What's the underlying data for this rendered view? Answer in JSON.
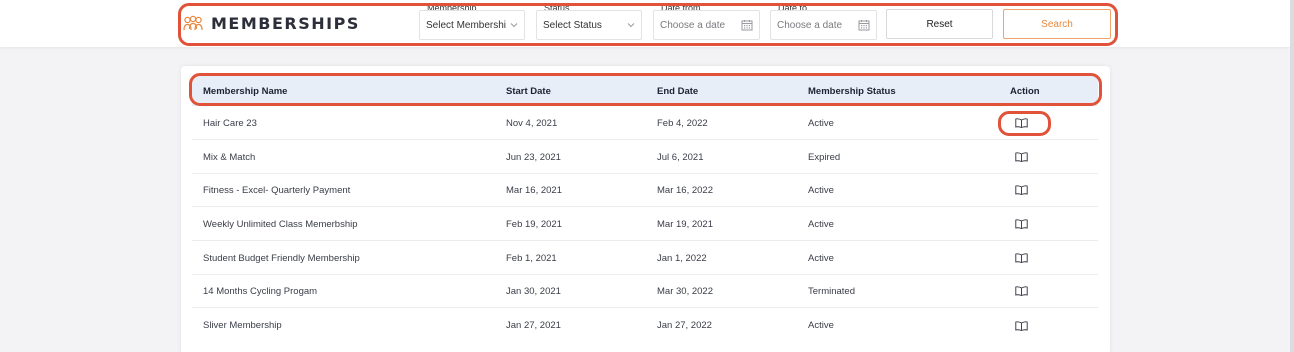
{
  "app": {
    "title": "MEMBERSHIPS",
    "logo_icon": "users-icon",
    "accent_color": "#e8883e",
    "highlight_color": "#e0533a"
  },
  "filters": {
    "membership": {
      "label": "Membership",
      "value": "Select Membershi",
      "icon": "chevron-down-icon"
    },
    "status": {
      "label": "Status",
      "value": "Select Status",
      "icon": "chevron-down-icon"
    },
    "date_from": {
      "label": "Date from",
      "placeholder": "Choose a date",
      "icon": "calendar-icon"
    },
    "date_to": {
      "label": "Date to",
      "placeholder": "Choose a date",
      "icon": "calendar-icon"
    },
    "reset_label": "Reset",
    "search_label": "Search"
  },
  "table": {
    "columns": [
      "Membership Name",
      "Start Date",
      "End Date",
      "Membership Status",
      "Action"
    ],
    "action_icon": "open-book-icon",
    "rows": [
      {
        "name": "Hair Care 23",
        "start": "Nov 4, 2021",
        "end": "Feb 4, 2022",
        "status": "Active"
      },
      {
        "name": "Mix & Match",
        "start": "Jun 23, 2021",
        "end": "Jul 6, 2021",
        "status": "Expired"
      },
      {
        "name": "Fitness - Excel- Quarterly Payment",
        "start": "Mar 16, 2021",
        "end": "Mar 16, 2022",
        "status": "Active"
      },
      {
        "name": "Weekly Unlimited Class Memerbship",
        "start": "Feb 19, 2021",
        "end": "Mar 19, 2021",
        "status": "Active"
      },
      {
        "name": "Student Budget Friendly Membership",
        "start": "Feb 1, 2021",
        "end": "Jan 1, 2022",
        "status": "Active"
      },
      {
        "name": "14 Months Cycling Progam",
        "start": "Jan 30, 2021",
        "end": "Mar 30, 2022",
        "status": "Terminated"
      },
      {
        "name": "Sliver Membership",
        "start": "Jan 27, 2021",
        "end": "Jan 27, 2022",
        "status": "Active"
      }
    ]
  }
}
